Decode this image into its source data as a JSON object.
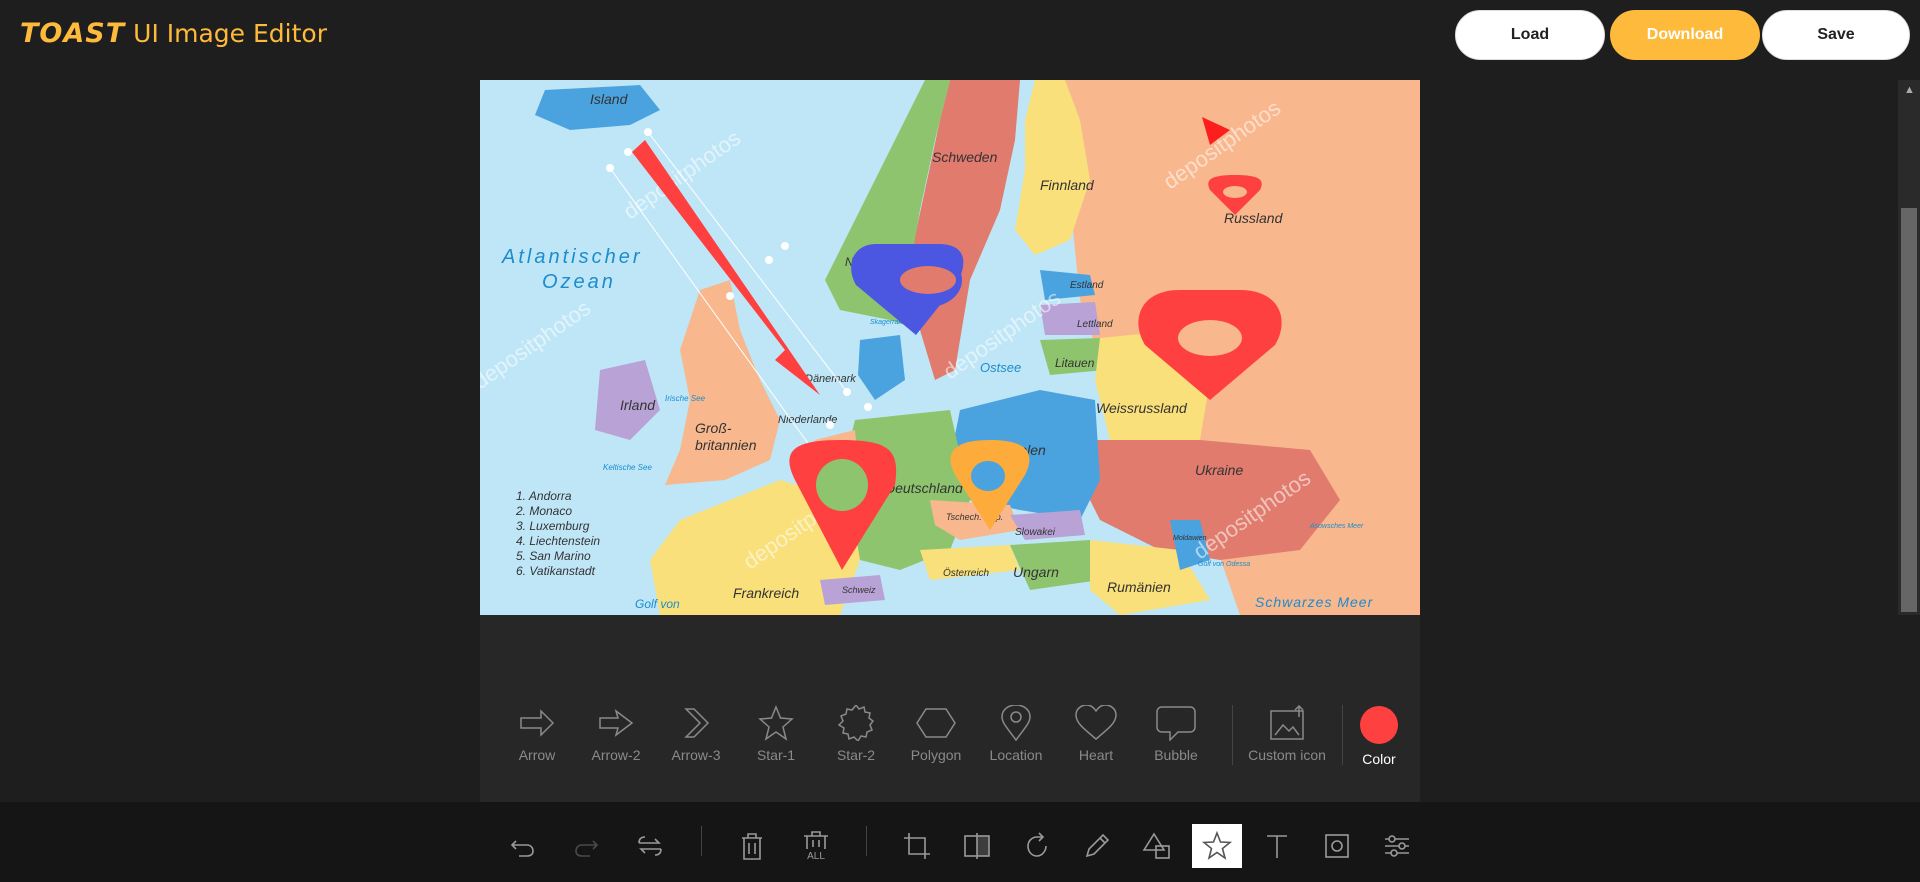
{
  "app": {
    "logo_brand": "TOAST",
    "logo_product": "UI Image Editor"
  },
  "header": {
    "load_label": "Load",
    "download_label": "Download",
    "save_label": "Save"
  },
  "map": {
    "labels": [
      "Island",
      "Schweden",
      "Finnland",
      "Russland",
      "Atlantischer",
      "Ozean",
      "Norwegen",
      "Estland",
      "Lettland",
      "Litauen",
      "Ostsee",
      "Dänemark",
      "Irland",
      "Groß-",
      "britannien",
      "Niederlande",
      "Weissrussland",
      "Polen",
      "Deutschland",
      "Ukraine",
      "Tschech. Rep.",
      "Slowakei",
      "Österreich",
      "Ungarn",
      "Rumänien",
      "Frankreich",
      "Schweiz",
      "Golf von",
      "Schwarzes Meer",
      "Irische See",
      "Keltische See",
      "Skagerrak",
      "Moldawien",
      "Golf von Odessa",
      "Asowsches Meer"
    ],
    "legend": [
      "1. Andorra",
      "2. Monaco",
      "3. Luxemburg",
      "4. Liechtenstein",
      "5. San Marino",
      "6. Vatikanstadt"
    ],
    "watermark": "depositphotos"
  },
  "shape_menu": {
    "items": [
      {
        "label": "Arrow",
        "icon": "arrow-icon"
      },
      {
        "label": "Arrow-2",
        "icon": "arrow-2-icon"
      },
      {
        "label": "Arrow-3",
        "icon": "arrow-3-icon"
      },
      {
        "label": "Star-1",
        "icon": "star-1-icon"
      },
      {
        "label": "Star-2",
        "icon": "star-2-icon"
      },
      {
        "label": "Polygon",
        "icon": "polygon-icon"
      },
      {
        "label": "Location",
        "icon": "location-icon"
      },
      {
        "label": "Heart",
        "icon": "heart-icon"
      },
      {
        "label": "Bubble",
        "icon": "bubble-icon"
      }
    ],
    "custom_label": "Custom icon",
    "color_label": "Color",
    "color_value": "#ff4040"
  },
  "toolbar": {
    "items": [
      "undo-icon",
      "redo-icon",
      "reset-icon",
      "delete-icon",
      "delete-all-icon",
      "crop-icon",
      "flip-icon",
      "rotate-icon",
      "draw-icon",
      "shape-icon",
      "icon-tool-icon",
      "text-icon",
      "mask-icon",
      "filter-icon"
    ],
    "delete_all_text": "ALL",
    "active": "icon-tool-icon"
  },
  "colors": {
    "accent": "#fdba3b",
    "red": "#ff4040",
    "blue": "#4b57e0",
    "orange": "#fdab3b"
  }
}
